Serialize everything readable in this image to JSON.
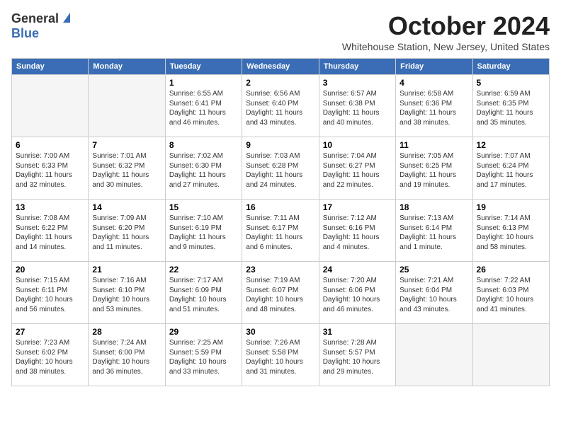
{
  "header": {
    "logo_general": "General",
    "logo_blue": "Blue",
    "month_title": "October 2024",
    "location": "Whitehouse Station, New Jersey, United States"
  },
  "weekdays": [
    "Sunday",
    "Monday",
    "Tuesday",
    "Wednesday",
    "Thursday",
    "Friday",
    "Saturday"
  ],
  "weeks": [
    [
      {
        "day": "",
        "text": ""
      },
      {
        "day": "",
        "text": ""
      },
      {
        "day": "1",
        "text": "Sunrise: 6:55 AM\nSunset: 6:41 PM\nDaylight: 11 hours and 46 minutes."
      },
      {
        "day": "2",
        "text": "Sunrise: 6:56 AM\nSunset: 6:40 PM\nDaylight: 11 hours and 43 minutes."
      },
      {
        "day": "3",
        "text": "Sunrise: 6:57 AM\nSunset: 6:38 PM\nDaylight: 11 hours and 40 minutes."
      },
      {
        "day": "4",
        "text": "Sunrise: 6:58 AM\nSunset: 6:36 PM\nDaylight: 11 hours and 38 minutes."
      },
      {
        "day": "5",
        "text": "Sunrise: 6:59 AM\nSunset: 6:35 PM\nDaylight: 11 hours and 35 minutes."
      }
    ],
    [
      {
        "day": "6",
        "text": "Sunrise: 7:00 AM\nSunset: 6:33 PM\nDaylight: 11 hours and 32 minutes."
      },
      {
        "day": "7",
        "text": "Sunrise: 7:01 AM\nSunset: 6:32 PM\nDaylight: 11 hours and 30 minutes."
      },
      {
        "day": "8",
        "text": "Sunrise: 7:02 AM\nSunset: 6:30 PM\nDaylight: 11 hours and 27 minutes."
      },
      {
        "day": "9",
        "text": "Sunrise: 7:03 AM\nSunset: 6:28 PM\nDaylight: 11 hours and 24 minutes."
      },
      {
        "day": "10",
        "text": "Sunrise: 7:04 AM\nSunset: 6:27 PM\nDaylight: 11 hours and 22 minutes."
      },
      {
        "day": "11",
        "text": "Sunrise: 7:05 AM\nSunset: 6:25 PM\nDaylight: 11 hours and 19 minutes."
      },
      {
        "day": "12",
        "text": "Sunrise: 7:07 AM\nSunset: 6:24 PM\nDaylight: 11 hours and 17 minutes."
      }
    ],
    [
      {
        "day": "13",
        "text": "Sunrise: 7:08 AM\nSunset: 6:22 PM\nDaylight: 11 hours and 14 minutes."
      },
      {
        "day": "14",
        "text": "Sunrise: 7:09 AM\nSunset: 6:20 PM\nDaylight: 11 hours and 11 minutes."
      },
      {
        "day": "15",
        "text": "Sunrise: 7:10 AM\nSunset: 6:19 PM\nDaylight: 11 hours and 9 minutes."
      },
      {
        "day": "16",
        "text": "Sunrise: 7:11 AM\nSunset: 6:17 PM\nDaylight: 11 hours and 6 minutes."
      },
      {
        "day": "17",
        "text": "Sunrise: 7:12 AM\nSunset: 6:16 PM\nDaylight: 11 hours and 4 minutes."
      },
      {
        "day": "18",
        "text": "Sunrise: 7:13 AM\nSunset: 6:14 PM\nDaylight: 11 hours and 1 minute."
      },
      {
        "day": "19",
        "text": "Sunrise: 7:14 AM\nSunset: 6:13 PM\nDaylight: 10 hours and 58 minutes."
      }
    ],
    [
      {
        "day": "20",
        "text": "Sunrise: 7:15 AM\nSunset: 6:11 PM\nDaylight: 10 hours and 56 minutes."
      },
      {
        "day": "21",
        "text": "Sunrise: 7:16 AM\nSunset: 6:10 PM\nDaylight: 10 hours and 53 minutes."
      },
      {
        "day": "22",
        "text": "Sunrise: 7:17 AM\nSunset: 6:09 PM\nDaylight: 10 hours and 51 minutes."
      },
      {
        "day": "23",
        "text": "Sunrise: 7:19 AM\nSunset: 6:07 PM\nDaylight: 10 hours and 48 minutes."
      },
      {
        "day": "24",
        "text": "Sunrise: 7:20 AM\nSunset: 6:06 PM\nDaylight: 10 hours and 46 minutes."
      },
      {
        "day": "25",
        "text": "Sunrise: 7:21 AM\nSunset: 6:04 PM\nDaylight: 10 hours and 43 minutes."
      },
      {
        "day": "26",
        "text": "Sunrise: 7:22 AM\nSunset: 6:03 PM\nDaylight: 10 hours and 41 minutes."
      }
    ],
    [
      {
        "day": "27",
        "text": "Sunrise: 7:23 AM\nSunset: 6:02 PM\nDaylight: 10 hours and 38 minutes."
      },
      {
        "day": "28",
        "text": "Sunrise: 7:24 AM\nSunset: 6:00 PM\nDaylight: 10 hours and 36 minutes."
      },
      {
        "day": "29",
        "text": "Sunrise: 7:25 AM\nSunset: 5:59 PM\nDaylight: 10 hours and 33 minutes."
      },
      {
        "day": "30",
        "text": "Sunrise: 7:26 AM\nSunset: 5:58 PM\nDaylight: 10 hours and 31 minutes."
      },
      {
        "day": "31",
        "text": "Sunrise: 7:28 AM\nSunset: 5:57 PM\nDaylight: 10 hours and 29 minutes."
      },
      {
        "day": "",
        "text": ""
      },
      {
        "day": "",
        "text": ""
      }
    ]
  ]
}
